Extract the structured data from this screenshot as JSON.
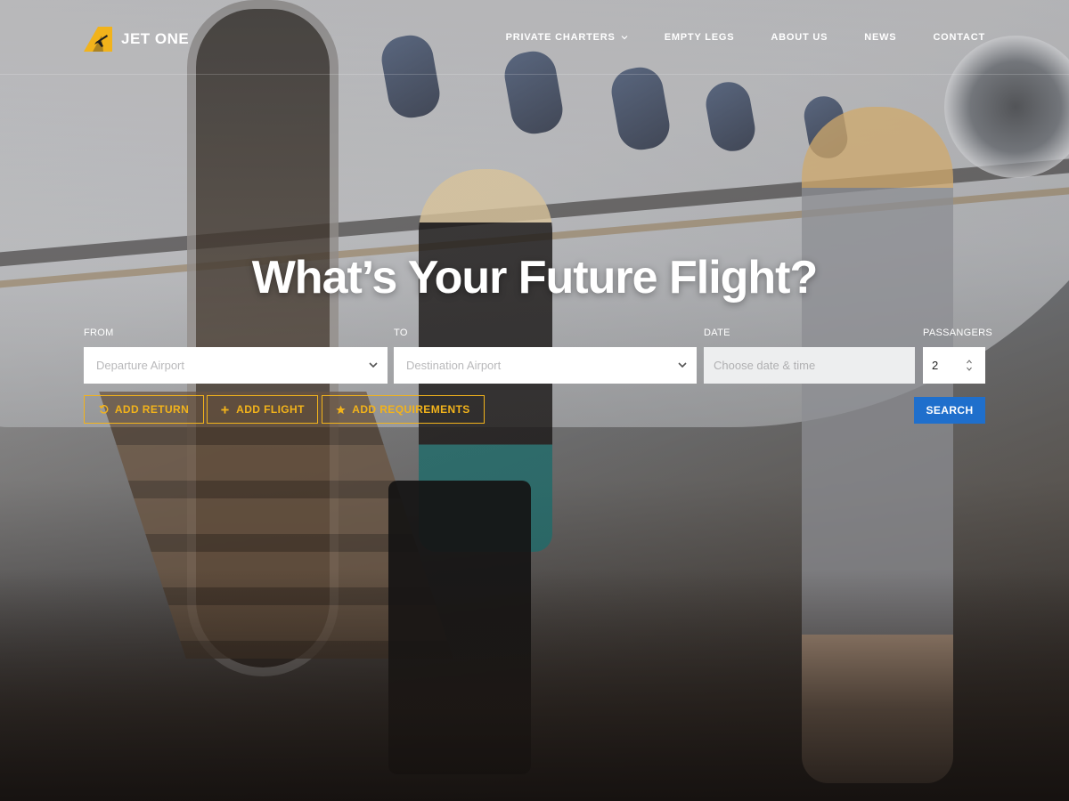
{
  "brand": {
    "name": "JET ONE",
    "accent": "#f2b31b"
  },
  "nav": {
    "items": [
      {
        "label": "PRIVATE CHARTERS",
        "has_dropdown": true
      },
      {
        "label": "EMPTY LEGS"
      },
      {
        "label": "ABOUT US"
      },
      {
        "label": "NEWS"
      },
      {
        "label": "CONTACT"
      }
    ]
  },
  "hero": {
    "title": "What’s Your Future Flight?"
  },
  "search": {
    "from": {
      "label": "FROM",
      "placeholder": "Departure Airport"
    },
    "to": {
      "label": "TO",
      "placeholder": "Destination Airport"
    },
    "date": {
      "label": "DATE",
      "placeholder": "Choose date & time"
    },
    "passengers": {
      "label": "PASSANGERS",
      "value": "2"
    },
    "buttons": {
      "add_return": "ADD RETURN",
      "add_flight": "ADD FLIGHT",
      "add_requirements": "ADD REQUIREMENTS",
      "search": "SEARCH"
    },
    "search_color": "#1f6fcc"
  }
}
